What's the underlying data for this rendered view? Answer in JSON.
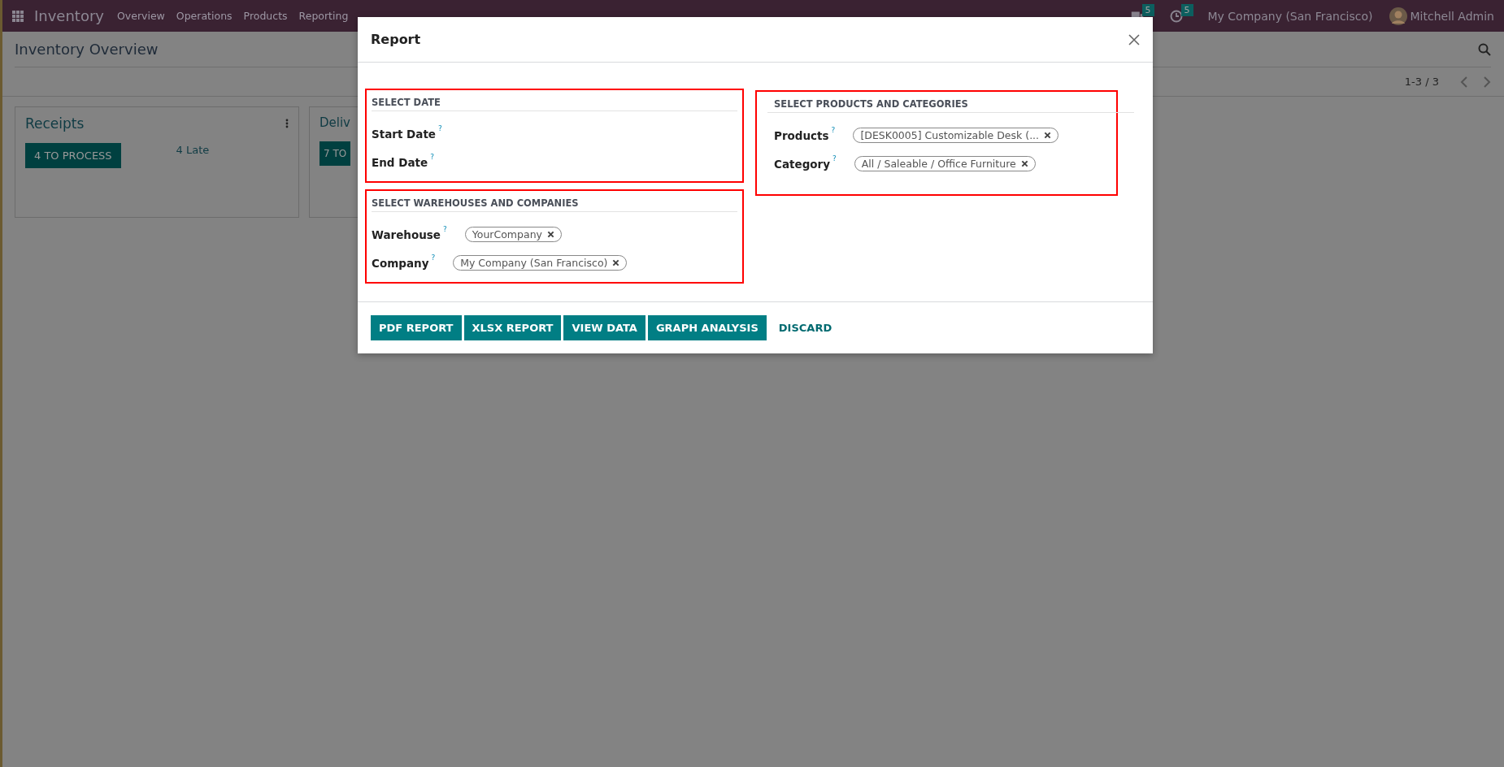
{
  "navbar": {
    "app": "Inventory",
    "menu": [
      "Overview",
      "Operations",
      "Products",
      "Reporting"
    ],
    "messages_badge": "5",
    "activities_badge": "5",
    "company": "My Company (San Francisco)",
    "user": "Mitchell Admin"
  },
  "page": {
    "title": "Inventory Overview",
    "pager": "1-3 / 3"
  },
  "cards": [
    {
      "title": "Receipts",
      "button": "4 TO PROCESS",
      "late": "4 Late"
    },
    {
      "title": "Deliv",
      "button": "7 TO"
    }
  ],
  "dialog": {
    "title": "Report",
    "sections": [
      {
        "heading": "SELECT DATE",
        "fields": [
          {
            "label": "Start Date",
            "help": "?"
          },
          {
            "label": "End Date",
            "help": "?"
          }
        ]
      },
      {
        "heading": "SELECT WAREHOUSES AND COMPANIES",
        "fields": [
          {
            "label": "Warehouse",
            "help": "?",
            "tags": [
              "YourCompany"
            ]
          },
          {
            "label": "Company",
            "help": "?",
            "tags": [
              "My Company (San Francisco)"
            ]
          }
        ]
      },
      {
        "heading": "SELECT PRODUCTS AND CATEGORIES",
        "fields": [
          {
            "label": "Products",
            "help": "?",
            "tags": [
              "[DESK0005] Customizable Desk (..."
            ]
          },
          {
            "label": "Category",
            "help": "?",
            "tags": [
              "All / Saleable / Office Furniture"
            ]
          }
        ]
      }
    ],
    "buttons": [
      {
        "label": "PDF REPORT",
        "kind": "primary"
      },
      {
        "label": "XLSX REPORT",
        "kind": "primary"
      },
      {
        "label": "VIEW DATA",
        "kind": "primary"
      },
      {
        "label": "GRAPH ANALYSIS",
        "kind": "primary"
      },
      {
        "label": "DISCARD",
        "kind": "link"
      }
    ]
  }
}
